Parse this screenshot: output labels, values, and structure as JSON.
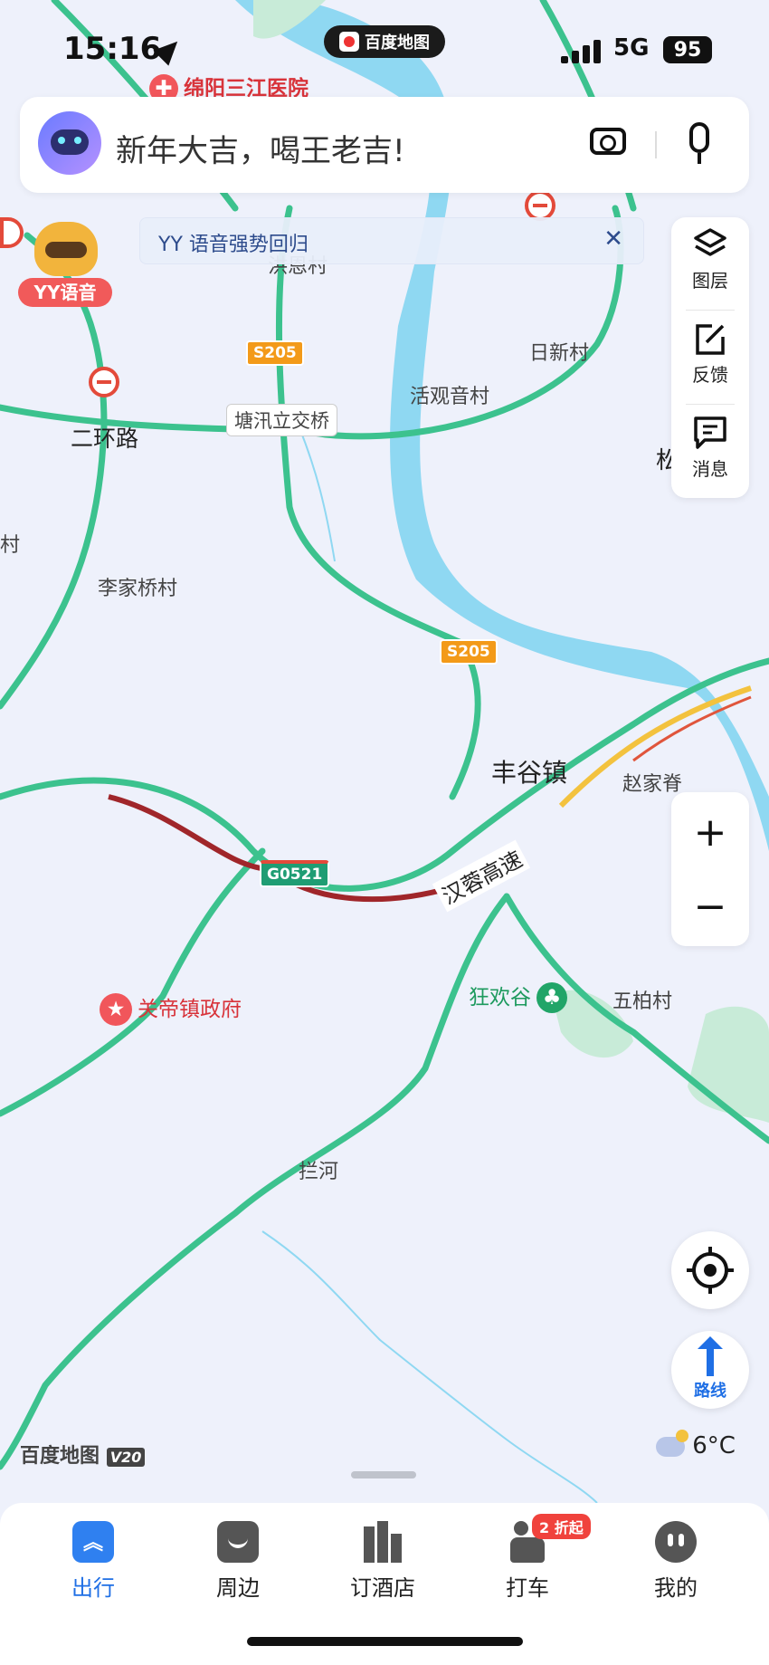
{
  "status_bar": {
    "time": "15:16",
    "app_pill": "百度地图",
    "network": "5G",
    "battery": "95"
  },
  "search": {
    "placeholder": "新年大吉，喝王老吉!"
  },
  "banner": {
    "text": "YY 语音强势回归"
  },
  "mascot": {
    "label": "YY语音"
  },
  "side_panel": {
    "layers": "图层",
    "feedback": "反馈",
    "messages": "消息"
  },
  "zoom": {
    "in": "+",
    "out": "−"
  },
  "route_button": {
    "label": "路线"
  },
  "weather": {
    "temp": "6°C"
  },
  "brand": {
    "text": "百度地图",
    "version": "V20"
  },
  "map": {
    "hospital": "绵阳三江医院",
    "labels": {
      "hongen": "洪恩村",
      "s205_a": "S205",
      "rixin": "日新村",
      "huoguanyin": "活观音村",
      "tangxun": "塘汛立交桥",
      "erhuan": "二环路",
      "song": "松",
      "cun": "村",
      "lijiaqiao": "李家桥村",
      "s205_b": "S205",
      "fenggu": "丰谷镇",
      "zhaojiaji": "赵家脊",
      "g0521": "G0521",
      "hanrong": "汉蓉高速",
      "guandi": "关帝镇政府",
      "kuanghuan": "狂欢谷",
      "wubai": "五柏村",
      "lanhe": "拦河"
    }
  },
  "tabbar": {
    "tabs": [
      {
        "label": "出行",
        "active": true
      },
      {
        "label": "周边",
        "active": false
      },
      {
        "label": "订酒店",
        "active": false
      },
      {
        "label": "打车",
        "active": false,
        "badge": "2 折起"
      },
      {
        "label": "我的",
        "active": false
      }
    ]
  },
  "colors": {
    "road": "#3cc28e",
    "river": "#8fd8f2",
    "accent": "#1f6fe5",
    "jam": "#a0262a",
    "slow": "#f3c23e"
  }
}
